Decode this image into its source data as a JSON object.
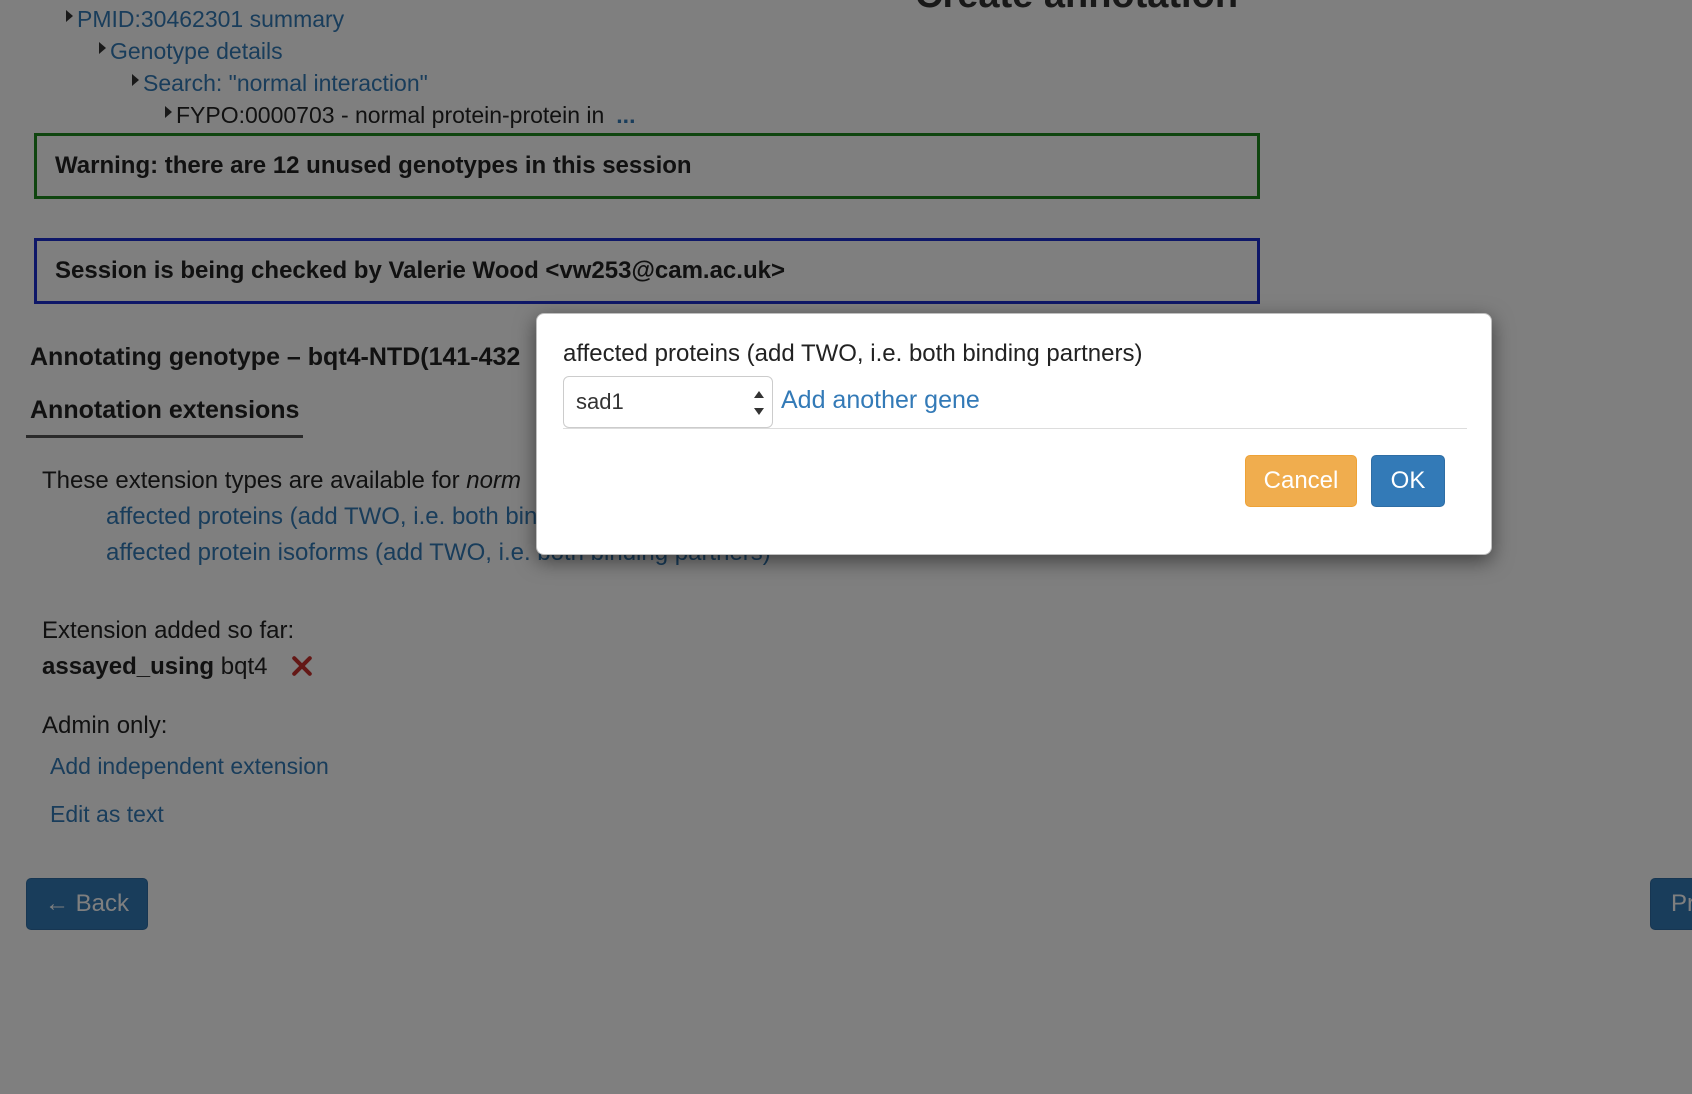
{
  "header": {
    "title": "Create annotation"
  },
  "breadcrumbs": [
    {
      "label": "PMID:30462301 summary",
      "link": true
    },
    {
      "label": "Genotype details",
      "link": true
    },
    {
      "label": "Search: \"normal interaction\"",
      "link": true
    },
    {
      "label": "FYPO:0000703 - normal protein-protein in",
      "link": false,
      "more": "..."
    }
  ],
  "alerts": {
    "warning": "Warning: there are 12 unused genotypes in this session",
    "checking": "Session is being checked by Valerie Wood <vw253@cam.ac.uk>"
  },
  "annotation": {
    "title": "Annotating genotype – bqt4-NTD(141-432",
    "tab": "Annotation extensions",
    "available_prefix": "These extension types are available for ",
    "available_term": "norm",
    "extension_types": [
      "affected proteins (add TWO, i.e. both binding partners)",
      "affected protein isoforms (add TWO, i.e. both binding partners)"
    ],
    "added_label": "Extension added so far:",
    "added_relation": "assayed_using",
    "added_value": "bqt4",
    "admin_label": "Admin only:",
    "admin_links": [
      "Add independent extension",
      "Edit as text"
    ]
  },
  "nav": {
    "back": "← Back",
    "proceed": "Pr"
  },
  "modal": {
    "label": "affected proteins (add TWO, i.e. both binding partners)",
    "selected_gene": "sad1",
    "add_gene": "Add another gene",
    "cancel": "Cancel",
    "ok": "OK"
  },
  "colors": {
    "link": "#337ab7",
    "warning_border": "#1f8a1f",
    "checking_border": "#1c2fd0",
    "cancel_button": "#f0ad4e",
    "primary_button": "#337ab7",
    "remove_icon": "#c9302c"
  }
}
